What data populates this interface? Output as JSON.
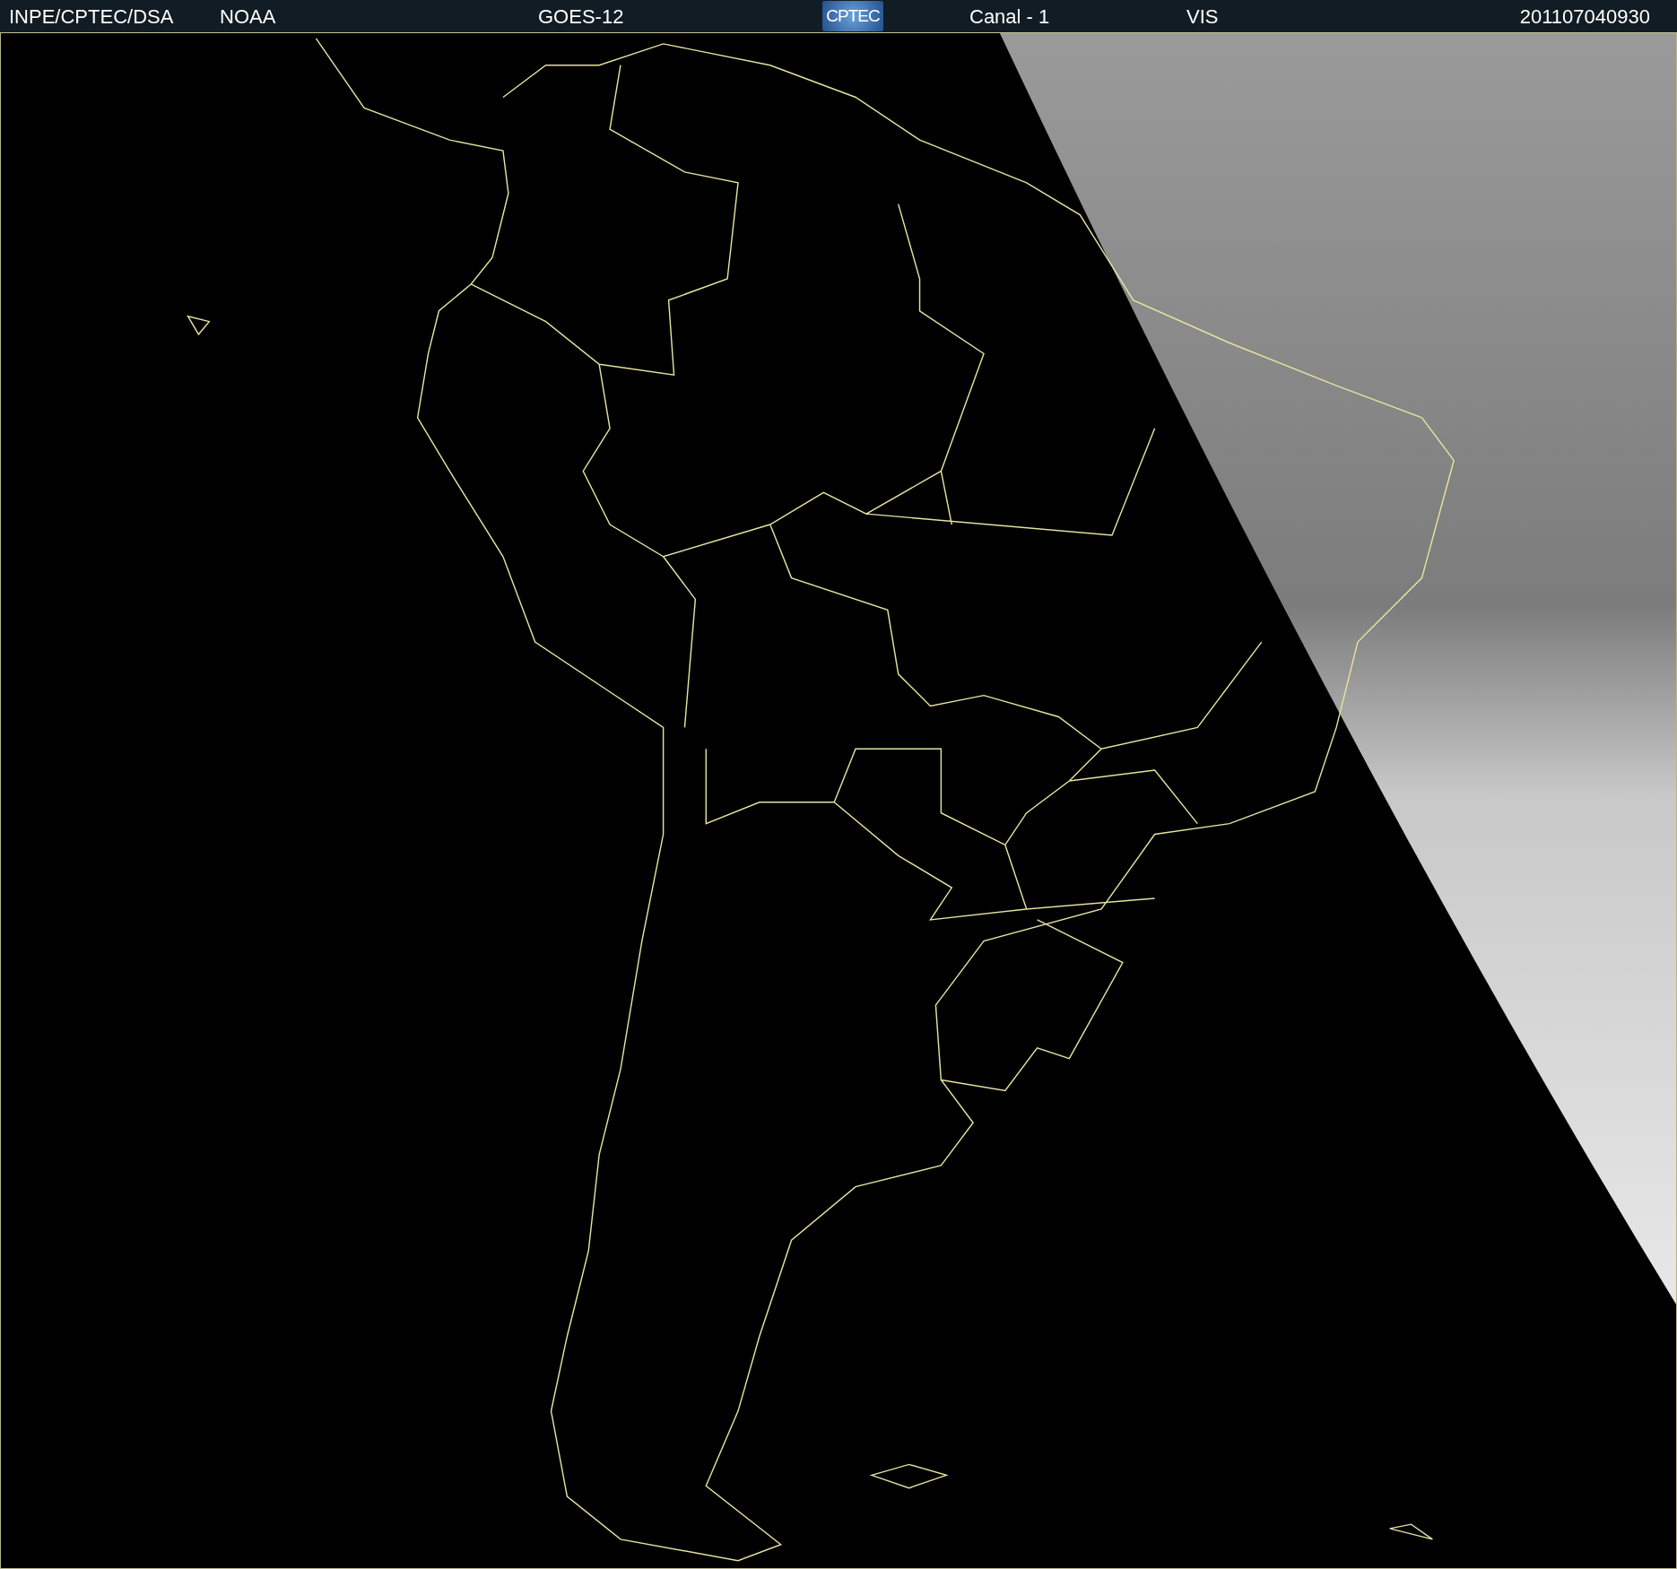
{
  "header": {
    "source": "INPE/CPTEC/DSA",
    "agency": "NOAA",
    "satellite": "GOES-12",
    "logo": "CPTEC",
    "channel": "Canal - 1",
    "band": "VIS",
    "timestamp": "201107040930"
  }
}
